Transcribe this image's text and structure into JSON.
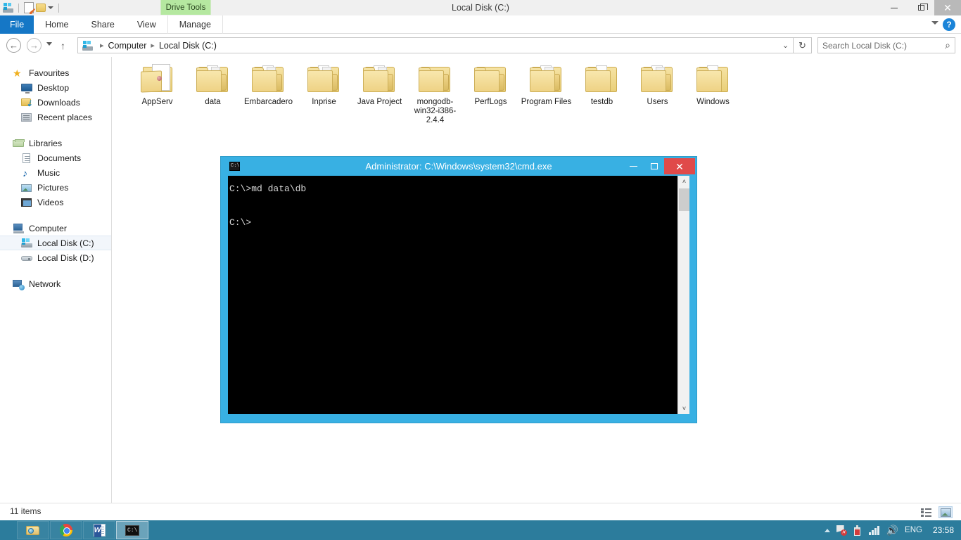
{
  "window": {
    "title": "Local Disk (C:)",
    "quick_access": [
      "drive-icon",
      "properties-icon",
      "new-folder-icon",
      "customize-caret-icon"
    ],
    "buttons": {
      "minimize": "minimize-icon",
      "maximize": "maximize-icon",
      "close": "close-icon"
    }
  },
  "contextual_tab": {
    "label": "Drive Tools"
  },
  "ribbon": {
    "tabs": [
      {
        "label": "File",
        "active": true
      },
      {
        "label": "Home",
        "active": false
      },
      {
        "label": "Share",
        "active": false
      },
      {
        "label": "View",
        "active": false
      },
      {
        "label": "Manage",
        "active": false
      }
    ],
    "help_label": "?"
  },
  "addressbar": {
    "back": "back-arrow-icon",
    "forward": "forward-arrow-icon",
    "up": "up-arrow-icon",
    "breadcrumbs": [
      "Computer",
      "Local Disk (C:)"
    ],
    "separator": "▸",
    "refresh_glyph": "↻",
    "dropdown_glyph": "⌄"
  },
  "search": {
    "placeholder": "Search Local Disk (C:)",
    "value": "",
    "icon_glyph": "⌕"
  },
  "navpane": {
    "groups": [
      {
        "header": {
          "label": "Favourites",
          "icon": "star-icon"
        },
        "items": [
          {
            "label": "Desktop",
            "icon": "desktop-icon"
          },
          {
            "label": "Downloads",
            "icon": "downloads-icon"
          },
          {
            "label": "Recent places",
            "icon": "recent-places-icon"
          }
        ]
      },
      {
        "header": {
          "label": "Libraries",
          "icon": "libraries-icon"
        },
        "items": [
          {
            "label": "Documents",
            "icon": "documents-icon"
          },
          {
            "label": "Music",
            "icon": "music-icon"
          },
          {
            "label": "Pictures",
            "icon": "pictures-icon"
          },
          {
            "label": "Videos",
            "icon": "videos-icon"
          }
        ]
      },
      {
        "header": {
          "label": "Computer",
          "icon": "computer-icon"
        },
        "items": [
          {
            "label": "Local Disk (C:)",
            "icon": "hard-disk-icon",
            "selected": true
          },
          {
            "label": "Local Disk (D:)",
            "icon": "disk-drive-icon",
            "selected": false
          }
        ]
      },
      {
        "header": {
          "label": "Network",
          "icon": "network-icon"
        },
        "items": []
      }
    ]
  },
  "files": [
    {
      "name": "AppServ",
      "icon": "open-folder-icon"
    },
    {
      "name": "data",
      "icon": "folder-icon"
    },
    {
      "name": "Embarcadero",
      "icon": "folder-icon"
    },
    {
      "name": "Inprise",
      "icon": "folder-icon"
    },
    {
      "name": "Java Project",
      "icon": "folder-icon"
    },
    {
      "name": "mongodb-win32-i386-2.4.4",
      "icon": "folder-icon"
    },
    {
      "name": "PerfLogs",
      "icon": "folder-icon"
    },
    {
      "name": "Program Files",
      "icon": "folder-icon"
    },
    {
      "name": "testdb",
      "icon": "folder-icon"
    },
    {
      "name": "Users",
      "icon": "folder-icon"
    },
    {
      "name": "Windows",
      "icon": "folder-icon"
    }
  ],
  "cmd": {
    "title": "Administrator: C:\\Windows\\system32\\cmd.exe",
    "icon": "cmd-icon",
    "lines": "C:\\>md data\\db\n\nC:\\>",
    "buttons": {
      "minimize": "minimize-icon",
      "maximize": "maximize-icon",
      "close": "close-icon"
    },
    "scroll_up_glyph": "˄",
    "scroll_down_glyph": "˅",
    "border_color": "#38b0e3",
    "close_color": "#e04a4a"
  },
  "statusbar": {
    "item_count": "11 items",
    "views": [
      {
        "name": "details-view-button",
        "selected": false
      },
      {
        "name": "large-icons-view-button",
        "selected": true
      }
    ]
  },
  "taskbar": {
    "items": [
      {
        "name": "file-explorer",
        "icon": "explorer-icon",
        "active": false
      },
      {
        "name": "google-chrome",
        "icon": "chrome-icon",
        "active": false
      },
      {
        "name": "microsoft-word",
        "icon": "word-icon",
        "active": false
      },
      {
        "name": "command-prompt",
        "icon": "cmd-icon",
        "active": true
      }
    ],
    "tray": {
      "expand_glyph": "▲",
      "icons": [
        "action-center-flag-icon",
        "battery-icon",
        "network-signal-icon",
        "volume-icon"
      ],
      "language": "ENG",
      "clock": "23:58"
    },
    "background_color": "#2c7c9c"
  }
}
